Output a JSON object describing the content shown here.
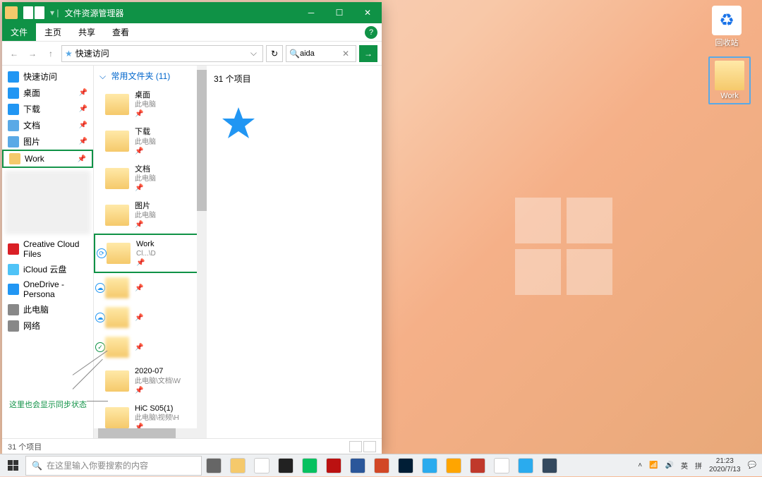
{
  "desktop": {
    "recycle_bin": "回收站",
    "work": "Work"
  },
  "explorer": {
    "title": "文件资源管理器",
    "menu": {
      "file": "文件",
      "home": "主页",
      "share": "共享",
      "view": "查看"
    },
    "address": "快速访问",
    "search_value": "aida",
    "sidebar": {
      "quick_access": "快速访问",
      "desktop": "桌面",
      "downloads": "下载",
      "documents": "文档",
      "pictures": "图片",
      "work": "Work",
      "ccf": "Creative Cloud Files",
      "icloud": "iCloud 云盘",
      "onedrive": "OneDrive - Persona",
      "this_pc": "此电脑",
      "network": "网络"
    },
    "folder_header": "常用文件夹 (11)",
    "folders": [
      {
        "name": "桌面",
        "sub": "此电脑"
      },
      {
        "name": "下载",
        "sub": "此电脑"
      },
      {
        "name": "文档",
        "sub": "此电脑"
      },
      {
        "name": "图片",
        "sub": "此电脑"
      },
      {
        "name": "Work",
        "sub": "Cl...\\D"
      },
      {
        "name": "",
        "sub": ""
      },
      {
        "name": "",
        "sub": ""
      },
      {
        "name": "",
        "sub": ""
      },
      {
        "name": "2020-07",
        "sub": "此电脑\\文档\\W"
      },
      {
        "name": "HiC S05(1)",
        "sub": "此电脑\\视频\\H"
      }
    ],
    "item_count": "31 个项目",
    "status": "31 个项目"
  },
  "annotation": "这里也会显示同步状态",
  "taskbar": {
    "search_placeholder": "在这里输入你要搜索的内容",
    "tray": {
      "ime": "英",
      "ime2": "拼",
      "time": "21:23",
      "date": "2020/7/13"
    },
    "apps": [
      {
        "name": "task-view",
        "color": "#666"
      },
      {
        "name": "explorer",
        "color": "#f5c96b"
      },
      {
        "name": "chrome",
        "color": "#fff"
      },
      {
        "name": "store",
        "color": "#222"
      },
      {
        "name": "wechat",
        "color": "#07c160"
      },
      {
        "name": "adobe",
        "color": "#b11"
      },
      {
        "name": "word",
        "color": "#2b579a"
      },
      {
        "name": "powerpoint",
        "color": "#d24726"
      },
      {
        "name": "photoshop",
        "color": "#001e36"
      },
      {
        "name": "telegram",
        "color": "#2aabee"
      },
      {
        "name": "star",
        "color": "#ffa500"
      },
      {
        "name": "app1",
        "color": "#c0392b"
      },
      {
        "name": "text",
        "color": "#fff"
      },
      {
        "name": "spiral",
        "color": "#2aabee"
      },
      {
        "name": "castle",
        "color": "#34495e"
      }
    ]
  }
}
